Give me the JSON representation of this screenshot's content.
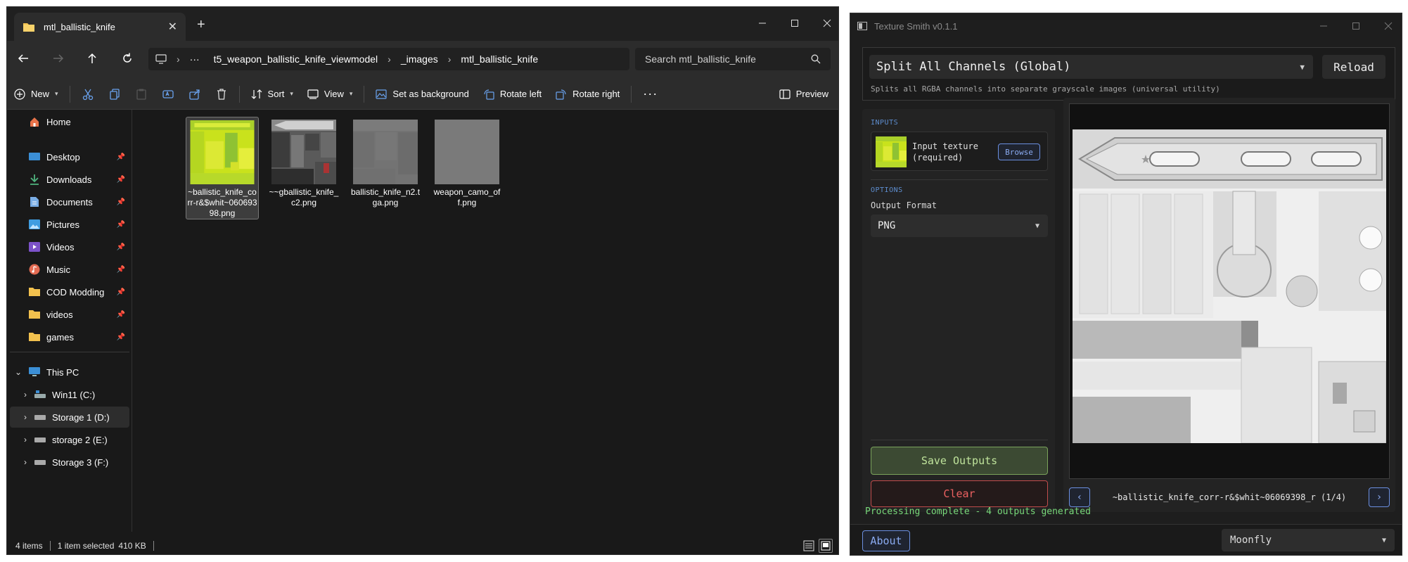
{
  "explorer": {
    "tab_title": "mtl_ballistic_knife",
    "breadcrumb": [
      "t5_weapon_ballistic_knife_viewmodel",
      "_images",
      "mtl_ballistic_knife"
    ],
    "ellipsis": "···",
    "search_placeholder": "Search mtl_ballistic_knife",
    "toolbar": {
      "new": "New",
      "sort": "Sort",
      "view": "View",
      "set_background": "Set as background",
      "rotate_left": "Rotate left",
      "rotate_right": "Rotate right",
      "preview": "Preview"
    },
    "nav": {
      "home": "Home",
      "pinned": [
        "Desktop",
        "Downloads",
        "Documents",
        "Pictures",
        "Videos",
        "Music",
        "COD Modding",
        "videos",
        "games"
      ],
      "this_pc": "This PC",
      "drives": [
        "Win11 (C:)",
        "Storage 1 (D:)",
        "storage 2 (E:)",
        "Storage 3 (F:)"
      ]
    },
    "files": [
      {
        "name": "~ballistic_knife_corr-r&$whit~06069398.png",
        "selected": true
      },
      {
        "name": "~~gballistic_knife_c2.png",
        "selected": false
      },
      {
        "name": "ballistic_knife_n2.tga.png",
        "selected": false
      },
      {
        "name": "weapon_camo_off.png",
        "selected": false
      }
    ],
    "status": {
      "items": "4 items",
      "selected": "1 item selected",
      "size": "410 KB"
    }
  },
  "texture_smith": {
    "title": "Texture Smith v0.1.1",
    "mode": "Split All Channels (Global)",
    "reload": "Reload",
    "mode_description": "Splits all RGBA channels into separate grayscale images (universal utility)",
    "inputs_header": "INPUTS",
    "input_label": "Input texture (required)",
    "browse": "Browse",
    "options_header": "OPTIONS",
    "output_format_label": "Output Format",
    "output_format": "PNG",
    "save_outputs": "Save Outputs",
    "clear": "Clear",
    "preview_name": "~ballistic_knife_corr-r&$whit~06069398_r (1/4)",
    "prev": "‹",
    "next": "›",
    "processing_status": "Processing complete - 4 outputs generated",
    "about": "About",
    "theme": "Moonfly"
  },
  "colors": {
    "accent_blue": "#6b8fe0",
    "success_green": "#78d87a",
    "danger_red": "#ec6161",
    "folder_yellow": "#f2c14e"
  }
}
